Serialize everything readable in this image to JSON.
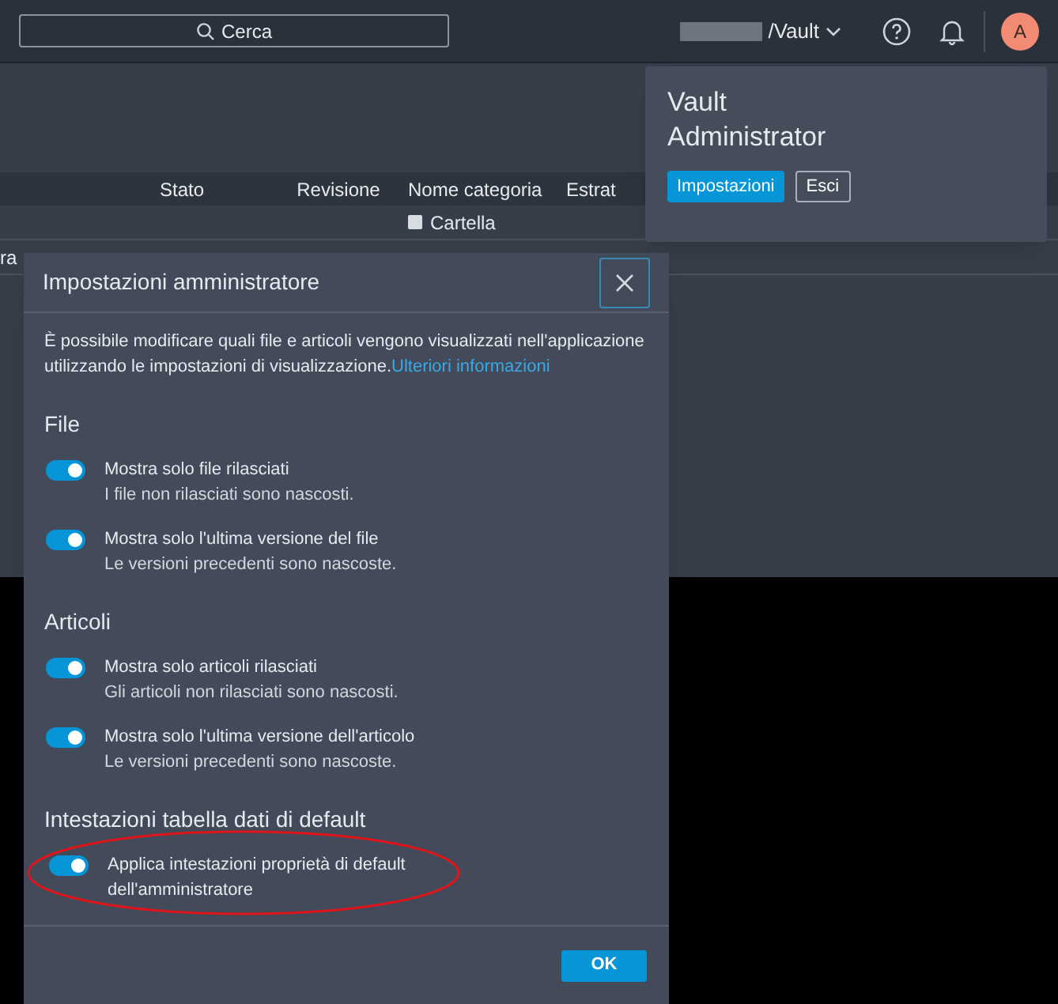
{
  "top_bar": {
    "search": {
      "placeholder": "Cerca"
    },
    "vault": "/Vault",
    "avatar": "A"
  },
  "table": {
    "columns": [
      "Stato",
      "Revisione",
      "Nome categoria",
      "Estrat"
    ],
    "rows": [
      {
        "cells": [
          "",
          "",
          "Cartella",
          ""
        ]
      },
      {
        "leading": "ra"
      }
    ]
  },
  "account_popover": {
    "name": "Vault Administrator",
    "buttons": [
      {
        "label": "Impostazioni",
        "kind": "primary"
      },
      {
        "label": "Esci",
        "kind": "secondary"
      }
    ]
  },
  "dialog": {
    "title": "Impostazioni amministratore",
    "intro": "È possibile modificare quali file e articoli vengono visualizzati nell'applicazione utilizzando le impostazioni di visualizzazione.",
    "link": "Ulteriori informazioni",
    "sections": [
      {
        "title": "File",
        "settings": [
          {
            "label": "Mostra solo file rilasciati",
            "description": "I file non rilasciati sono nascosti.",
            "on": true
          },
          {
            "label": "Mostra solo l'ultima versione del file",
            "description": "Le versioni precedenti sono nascoste.",
            "on": true
          }
        ]
      },
      {
        "title": "Articoli",
        "settings": [
          {
            "label": "Mostra solo articoli rilasciati",
            "description": "Gli articoli non rilasciati sono nascosti.",
            "on": true
          },
          {
            "label": "Mostra solo l'ultima versione dell'articolo",
            "description": "Le versioni precedenti sono nascoste.",
            "on": true
          }
        ]
      },
      {
        "title": "Intestazioni tabella dati di default",
        "settings": [
          {
            "label": "Applica intestazioni proprietà di default dell'amministratore",
            "on": true,
            "highlighted": true
          }
        ]
      }
    ],
    "ok": "OK"
  }
}
